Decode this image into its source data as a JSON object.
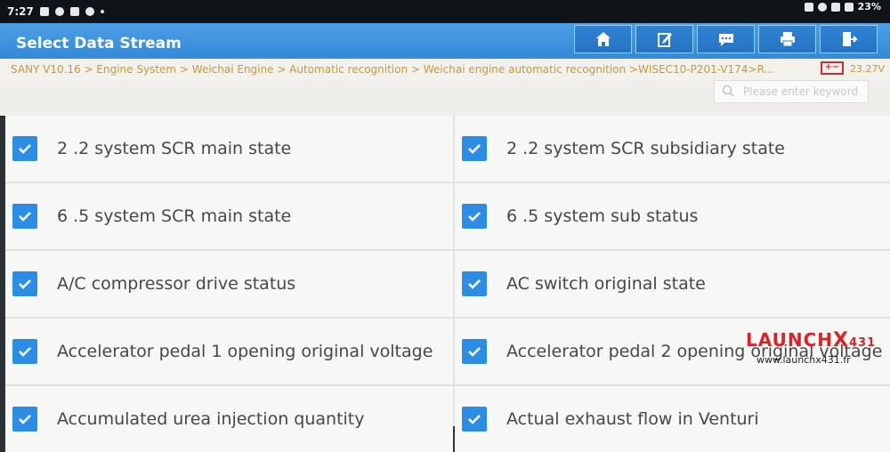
{
  "status_bar": {
    "time": "7:27",
    "battery": "23%",
    "left_icons": [
      "notification-icon",
      "settings-icon",
      "wifi-icon",
      "sync-icon",
      "dot-icon"
    ],
    "right_icons": [
      "nfc-icon",
      "vibrate-icon",
      "signal-icon",
      "battery-icon"
    ]
  },
  "header": {
    "title": "Select Data Stream",
    "buttons": [
      {
        "icon": "home-icon"
      },
      {
        "icon": "edit-icon"
      },
      {
        "icon": "message-icon"
      },
      {
        "icon": "print-icon"
      },
      {
        "icon": "exit-icon"
      }
    ]
  },
  "breadcrumb": {
    "path": "SANY V10.16 > Engine System > Weichai Engine > Automatic recognition  > Weichai engine automatic recognition >WISEC10-P201-V174>R...",
    "battery_icon": "+−",
    "voltage": "23.27V"
  },
  "search": {
    "placeholder": "Please enter keyword"
  },
  "items": [
    {
      "label": "2 .2 system SCR main state",
      "checked": true
    },
    {
      "label": "2 .2 system SCR subsidiary state",
      "checked": true
    },
    {
      "label": "6 .5 system SCR main state",
      "checked": true
    },
    {
      "label": "6 .5 system sub status",
      "checked": true
    },
    {
      "label": "A/C compressor drive status",
      "checked": true
    },
    {
      "label": "AC switch original state",
      "checked": true
    },
    {
      "label": "Accelerator pedal 1 opening original voltage",
      "checked": true
    },
    {
      "label": "Accelerator pedal 2 opening original voltage",
      "checked": true
    },
    {
      "label": "Accumulated urea injection quantity",
      "checked": true
    },
    {
      "label": "Actual exhaust flow in Venturi",
      "checked": true
    }
  ],
  "watermark": {
    "brand_main": "LAUNCH",
    "brand_x": "X",
    "brand_num": "431",
    "url": "www.launchx431.fr"
  },
  "colors": {
    "header": "#2f86d6",
    "checkbox": "#2b8ee4",
    "breadcrumb_text": "#c59a3a",
    "brand": "#d9232a"
  }
}
